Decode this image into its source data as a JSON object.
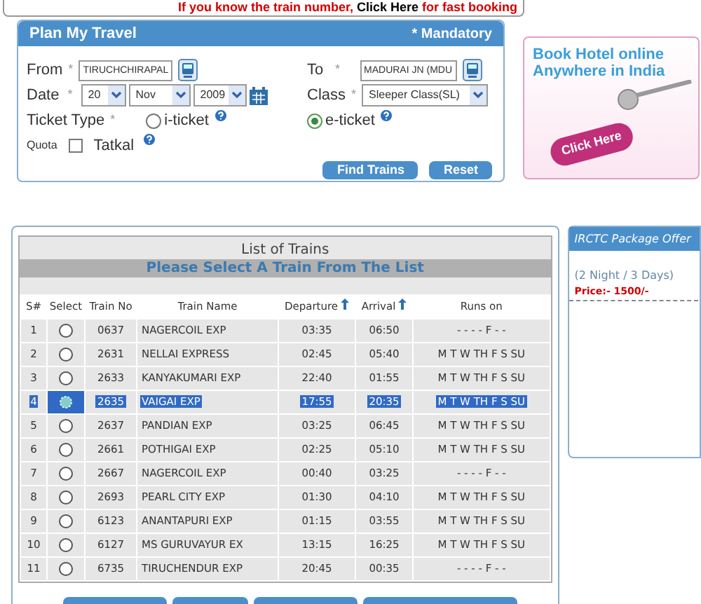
{
  "notice": {
    "before": "If you know the train number, ",
    "link": "Click Here",
    "after": " for fast booking"
  },
  "plan": {
    "title": "Plan My Travel",
    "mandatory": "* Mandatory",
    "from": {
      "label": "From",
      "required": "*",
      "value": "TIRUCHCHIRAPAL"
    },
    "to": {
      "label": "To",
      "required": "*",
      "value": "MADURAI JN (MDU"
    },
    "date": {
      "label": "Date",
      "required": "*",
      "day": "20",
      "month": "Nov",
      "year": "2009"
    },
    "class": {
      "label": "Class",
      "required": "*",
      "value": "Sleeper Class(SL)"
    },
    "ticket_type": {
      "label": "Ticket Type",
      "required": "*",
      "options": [
        {
          "label": "i-ticket",
          "selected": false
        },
        {
          "label": "e-ticket",
          "selected": true
        }
      ]
    },
    "quota": {
      "label": "Quota",
      "option": "Tatkal",
      "checked": false
    },
    "buttons": [
      "Find Trains",
      "Reset"
    ]
  },
  "ad": {
    "line_1": "Book Hotel online",
    "line_2": "Anywhere in India",
    "tag": "Click Here"
  },
  "trains": {
    "title": "List of Trains",
    "subtitle": "Please Select A Train From The List",
    "columns": [
      "S#",
      "Select",
      "Train No",
      "Train Name",
      "Departure",
      "Arrival",
      "Runs on"
    ],
    "rows": [
      {
        "n": "1",
        "no": "0637",
        "name": "NAGERCOIL EXP",
        "dep": "03:35",
        "arr": "06:50",
        "runs": "- - - - F - -",
        "selected": false
      },
      {
        "n": "2",
        "no": "2631",
        "name": "NELLAI EXPRESS",
        "dep": "02:45",
        "arr": "05:40",
        "runs": "M T W TH F S SU",
        "selected": false
      },
      {
        "n": "3",
        "no": "2633",
        "name": "KANYAKUMARI EXP",
        "dep": "22:40",
        "arr": "01:55",
        "runs": "M T W TH F S SU",
        "selected": false
      },
      {
        "n": "4",
        "no": "2635",
        "name": "VAIGAI EXP",
        "dep": "17:55",
        "arr": "20:35",
        "runs": "M T W TH F S SU",
        "selected": true
      },
      {
        "n": "5",
        "no": "2637",
        "name": "PANDIAN EXP",
        "dep": "03:25",
        "arr": "06:45",
        "runs": "M T W TH F S SU",
        "selected": false
      },
      {
        "n": "6",
        "no": "2661",
        "name": "POTHIGAI EXP",
        "dep": "02:25",
        "arr": "05:10",
        "runs": "M T W TH F S SU",
        "selected": false
      },
      {
        "n": "7",
        "no": "2667",
        "name": "NAGERCOIL EXP",
        "dep": "00:40",
        "arr": "03:25",
        "runs": "- - - - F - -",
        "selected": false
      },
      {
        "n": "8",
        "no": "2693",
        "name": "PEARL CITY EXP",
        "dep": "01:30",
        "arr": "04:10",
        "runs": "M T W TH F S SU",
        "selected": false
      },
      {
        "n": "9",
        "no": "6123",
        "name": "ANANTAPURI EXP",
        "dep": "01:15",
        "arr": "03:55",
        "runs": "M T W TH F S SU",
        "selected": false
      },
      {
        "n": "10",
        "no": "6127",
        "name": "MS GURUVAYUR EX",
        "dep": "13:15",
        "arr": "16:25",
        "runs": "M T W TH F S SU",
        "selected": false
      },
      {
        "n": "11",
        "no": "6735",
        "name": "TIRUCHENDUR EXP",
        "dep": "20:45",
        "arr": "00:35",
        "runs": "- - - - F - -",
        "selected": false
      }
    ]
  },
  "package": {
    "title": "IRCTC Package Offer",
    "duration": "(2 Night / 3 Days)",
    "price": "Price:- 1500/-"
  }
}
